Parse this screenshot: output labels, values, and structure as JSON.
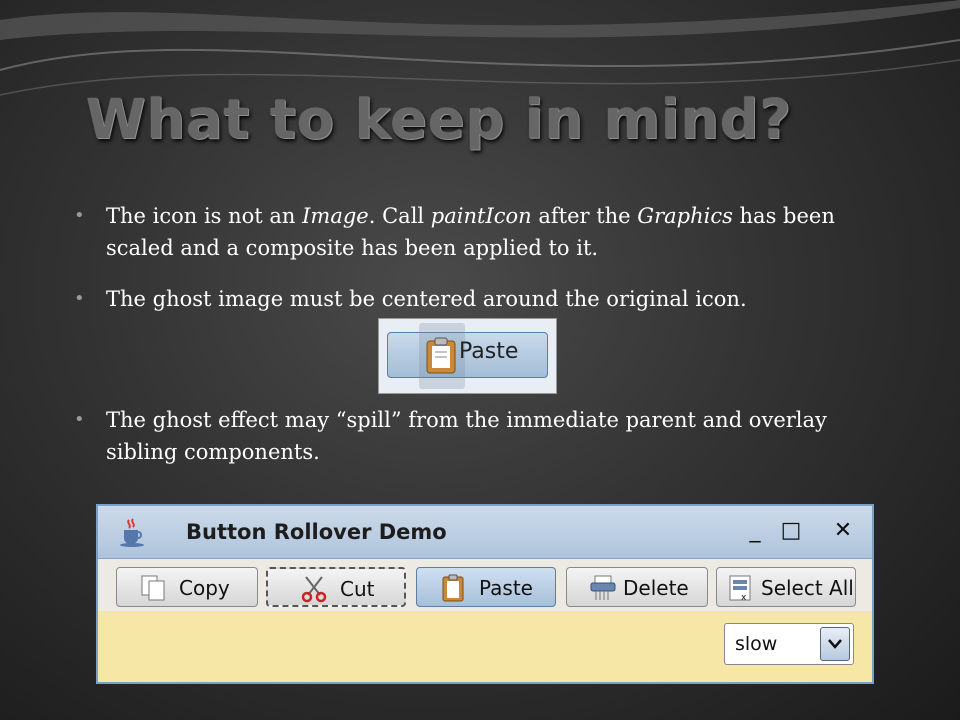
{
  "slide": {
    "title": "What to keep in mind?",
    "bullets": [
      {
        "parts": [
          "The icon is not an ",
          "Image",
          ". Call ",
          "paintIcon",
          " after the ",
          "Graphics",
          " has been scaled and a composite has been applied to it."
        ]
      },
      {
        "text": "The ghost image must be centered around the original icon."
      },
      {
        "text": "The ghost effect may “spill” from the immediate parent and overlay sibling components."
      }
    ]
  },
  "paste_example": {
    "label": "Paste"
  },
  "window": {
    "title": "Button Rollover Demo",
    "controls": {
      "minimize": "_",
      "maximize": "□",
      "close": "✕"
    },
    "toolbar": [
      {
        "label": "Copy",
        "icon": "copy-icon"
      },
      {
        "label": "Cut",
        "icon": "scissors-icon"
      },
      {
        "label": "Paste",
        "icon": "clipboard-icon"
      },
      {
        "label": "Delete",
        "icon": "shredder-icon"
      },
      {
        "label": "Select All",
        "icon": "select-all-icon"
      }
    ],
    "speed_select": {
      "value": "slow"
    }
  },
  "colors": {
    "titlebar": "#b8cbe0",
    "window_border": "#7c9fc6",
    "status_panel": "#f6e7a6",
    "paste_highlight": "#a6c0da"
  }
}
